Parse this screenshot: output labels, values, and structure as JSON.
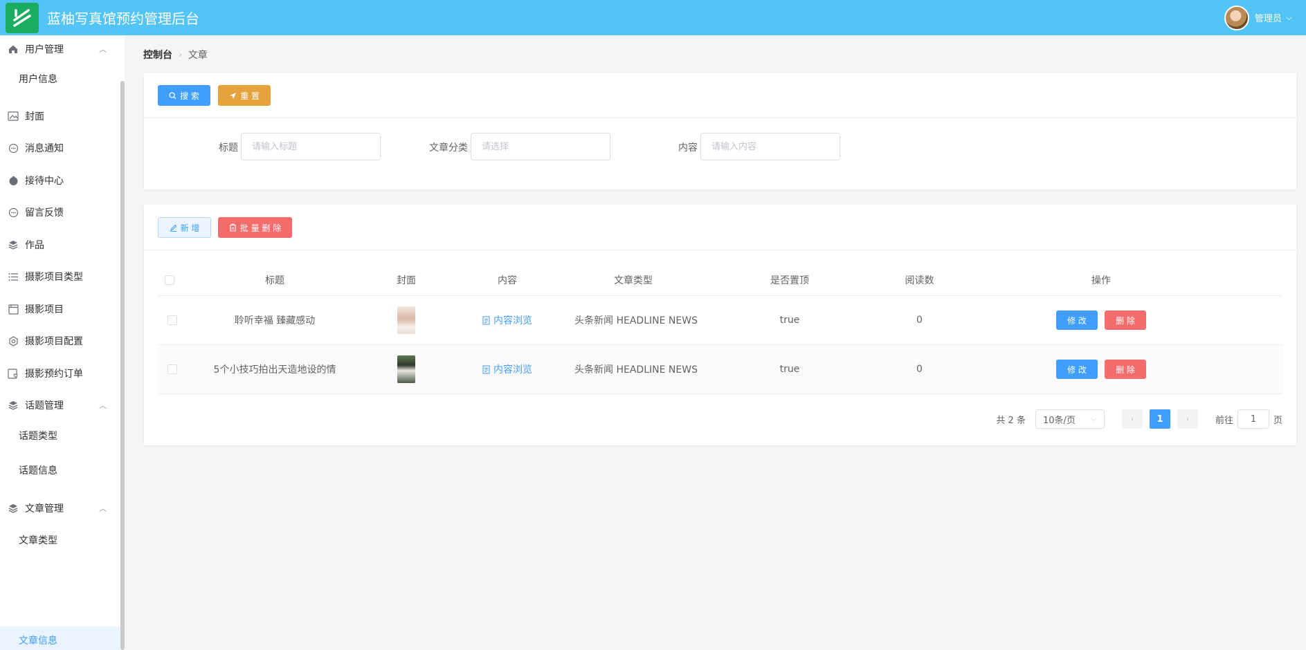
{
  "header": {
    "title": "蓝柚写真馆预约管理后台",
    "user_name": "管理员"
  },
  "sidebar": {
    "groups": [
      {
        "label": "用户管理",
        "icon": "home-icon",
        "children": [
          "用户信息"
        ]
      },
      {
        "label": "封面",
        "icon": "picture-icon"
      },
      {
        "label": "消息通知",
        "icon": "chat-dot-icon"
      },
      {
        "label": "接待中心",
        "icon": "reception-icon"
      },
      {
        "label": "留言反馈",
        "icon": "chat-dot-icon"
      },
      {
        "label": "作品",
        "icon": "layers-icon"
      },
      {
        "label": "摄影项目类型",
        "icon": "list-icon"
      },
      {
        "label": "摄影项目",
        "icon": "window-icon"
      },
      {
        "label": "摄影项目配置",
        "icon": "setting-icon"
      },
      {
        "label": "摄影预约订单",
        "icon": "order-icon"
      },
      {
        "label": "话题管理",
        "icon": "layers-icon",
        "children": [
          "话题类型",
          "话题信息"
        ]
      },
      {
        "label": "文章管理",
        "icon": "layers-icon",
        "children": [
          "文章类型",
          "文章信息"
        ]
      }
    ],
    "active_item": "文章信息"
  },
  "breadcrumb": {
    "home": "控制台",
    "current": "文章"
  },
  "search_toolbar": {
    "search_label": "搜 索",
    "reset_label": "重 置"
  },
  "filters": {
    "title_label": "标题",
    "title_placeholder": "请输入标题",
    "category_label": "文章分类",
    "category_placeholder": "请选择",
    "content_label": "内容",
    "content_placeholder": "请输入内容"
  },
  "list_toolbar": {
    "add_label": "新 增",
    "batch_delete_label": "批 量 删 除"
  },
  "table": {
    "columns": [
      "标题",
      "封面",
      "内容",
      "文章类型",
      "是否置顶",
      "阅读数",
      "操作"
    ],
    "rows": [
      {
        "title": "聆听幸福 臻藏感动",
        "content_link": "内容浏览",
        "type": "头条新闻 HEADLINE NEWS",
        "pinned": "true",
        "reads": "0",
        "edit": "修 改",
        "delete": "删 除"
      },
      {
        "title": "5个小技巧拍出天造地设的情",
        "content_link": "内容浏览",
        "type": "头条新闻 HEADLINE NEWS",
        "pinned": "true",
        "reads": "0",
        "edit": "修 改",
        "delete": "删 除"
      }
    ]
  },
  "pagination": {
    "total_text": "共 2 条",
    "page_size": "10条/页",
    "current_page": "1",
    "goto_prefix": "前往",
    "goto_value": "1",
    "goto_suffix": "页"
  },
  "colors": {
    "header_bg": "#52c4f5",
    "primary": "#409eff",
    "warning": "#e6a23c",
    "danger": "#f56c6c",
    "logo_bg": "#1aad5f"
  }
}
